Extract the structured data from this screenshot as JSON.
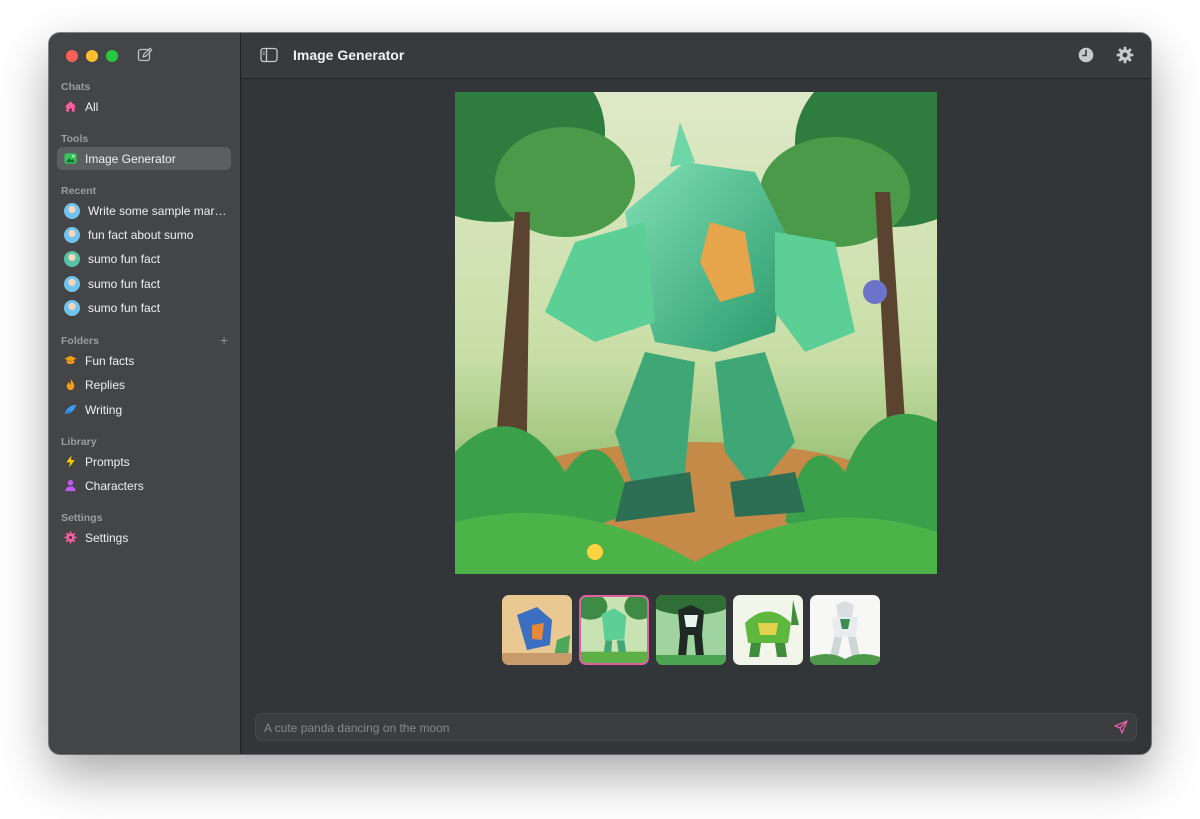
{
  "window": {
    "title": "Image Generator"
  },
  "sidebar": {
    "sections": {
      "chats": "Chats",
      "tools": "Tools",
      "recent": "Recent",
      "folders": "Folders",
      "library": "Library",
      "settings": "Settings"
    },
    "chats": [
      {
        "label": "All",
        "icon": "home-icon",
        "color": "#ff5fa2"
      }
    ],
    "tools": [
      {
        "label": "Image Generator",
        "icon": "image-icon",
        "color": "#34c759",
        "active": true
      }
    ],
    "recent": [
      {
        "label": "Write some sample mark…"
      },
      {
        "label": "fun fact about sumo"
      },
      {
        "label": "sumo fun fact"
      },
      {
        "label": "sumo fun fact"
      },
      {
        "label": "sumo fun fact"
      }
    ],
    "folders": [
      {
        "label": "Fun facts",
        "icon": "graduation-cap-icon",
        "color": "#ff9f0a"
      },
      {
        "label": "Replies",
        "icon": "flame-icon",
        "color": "#ff9f0a"
      },
      {
        "label": "Writing",
        "icon": "feather-icon",
        "color": "#3b9cff"
      }
    ],
    "library": [
      {
        "label": "Prompts",
        "icon": "bolt-icon",
        "color": "#ffcc00"
      },
      {
        "label": "Characters",
        "icon": "person-icon",
        "color": "#bf5af2"
      }
    ],
    "settings": [
      {
        "label": "Settings",
        "icon": "gear-icon",
        "color": "#ff5fa2"
      }
    ]
  },
  "gallery": {
    "thumbnail_count": 5,
    "selected_index": 1
  },
  "composer": {
    "placeholder": "A cute panda dancing on the moon",
    "send_color": "#e05fa3"
  }
}
